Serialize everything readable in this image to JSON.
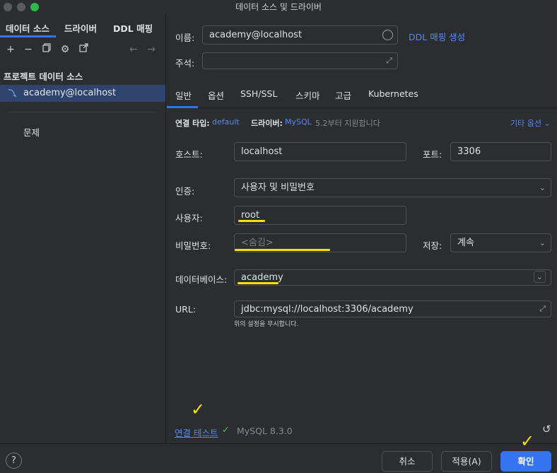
{
  "window": {
    "title": "데이터 소스 및 드라이버"
  },
  "left": {
    "tabs": [
      "데이터 소스",
      "드라이버",
      "DDL 매핑"
    ],
    "section_title": "프로젝트 데이터 소스",
    "selected_item": "academy@localhost",
    "problems_label": "문제"
  },
  "general": {
    "name_label": "이름:",
    "name_value": "academy@localhost",
    "ddl_link": "DDL 매핑 생성",
    "comment_label": "주석:",
    "comment_value": ""
  },
  "tabs": [
    "일반",
    "옵션",
    "SSH/SSL",
    "스키마",
    "고급",
    "Kubernetes"
  ],
  "connection": {
    "type_label": "연결 타입:",
    "type_value": "default",
    "driver_label": "드라이버:",
    "driver_value": "MySQL",
    "driver_note": "5.2부터 지원합니다",
    "other_options": "기타 옵션",
    "host_label": "호스트:",
    "host_value": "localhost",
    "port_label": "포트:",
    "port_value": "3306",
    "auth_label": "인증:",
    "auth_value": "사용자 및 비밀번호",
    "user_label": "사용자:",
    "user_value": "root",
    "password_label": "비밀번호:",
    "password_placeholder": "<숨김>",
    "save_label": "저장:",
    "save_value": "계속",
    "database_label": "데이터베이스:",
    "database_value": "academy",
    "url_label": "URL:",
    "url_value": "jdbc:mysql://localhost:3306/academy",
    "url_note": "위의 설정을 무시합니다."
  },
  "test": {
    "link_label": "연결 테스트",
    "status": "MySQL 8.3.0"
  },
  "footer": {
    "help": "?",
    "cancel": "취소",
    "apply": "적용(A)",
    "ok": "확인"
  },
  "colors": {
    "accent": "#3574f0",
    "link": "#548af7",
    "success": "#5fb865",
    "highlight": "#f2e300"
  }
}
